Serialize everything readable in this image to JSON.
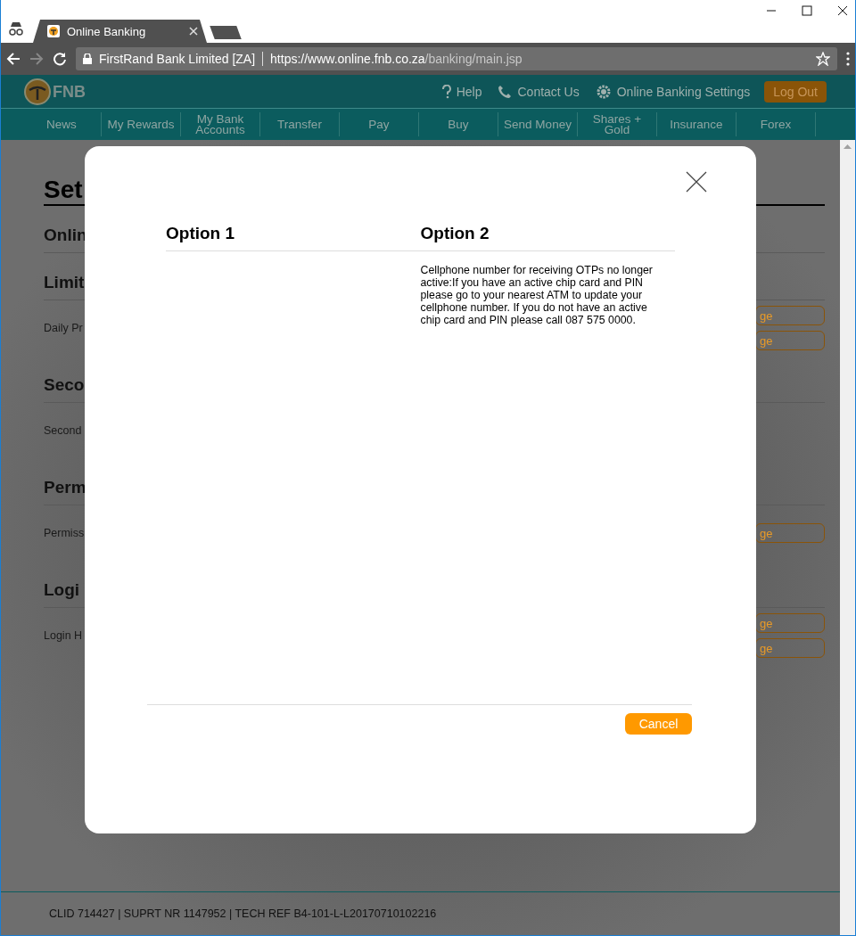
{
  "browser": {
    "tab_title": "Online Banking",
    "site_label": "FirstRand Bank Limited [ZA]",
    "url_host": "https://www.online.fnb.co.za",
    "url_path": "/banking/main.jsp",
    "forward_disabled": true
  },
  "header": {
    "logo_text": "FNB",
    "links": [
      {
        "kind": "help",
        "label": "Help"
      },
      {
        "kind": "phone",
        "label": "Contact Us"
      },
      {
        "kind": "gear",
        "label": "Online Banking Settings"
      }
    ],
    "logout": "Log Out"
  },
  "nav": [
    "News",
    "My Rewards",
    "My Bank Accounts",
    "Transfer",
    "Pay",
    "Buy",
    "Send Money",
    "Shares + Gold",
    "Insurance",
    "Forex"
  ],
  "page": {
    "title": "Set",
    "sections": [
      {
        "heading": "Onlin"
      },
      {
        "heading": "Limit",
        "label": "Daily Pr",
        "buttons": [
          "ge",
          "ge"
        ]
      },
      {
        "heading": "Seco",
        "label": "Second"
      },
      {
        "heading": "Perm",
        "label": "Permiss",
        "buttons": [
          "ge"
        ]
      },
      {
        "heading": "Logi",
        "label": "Login H",
        "buttons": [
          "ge",
          "ge"
        ]
      }
    ]
  },
  "modal": {
    "columns": [
      {
        "heading": "Option 1"
      },
      {
        "heading": "Option 2",
        "text": "Cellphone number for receiving OTPs no longer active:If you have an active chip card and PIN please go to your nearest ATM to update your cellphone number. If you do not have an active chip card and PIN please call 087 575 0000."
      }
    ],
    "cancel": "Cancel"
  },
  "footer": "CLID 714427 | SUPRT NR 1147952 | TECH REF B4-101-L-L20170710102216"
}
